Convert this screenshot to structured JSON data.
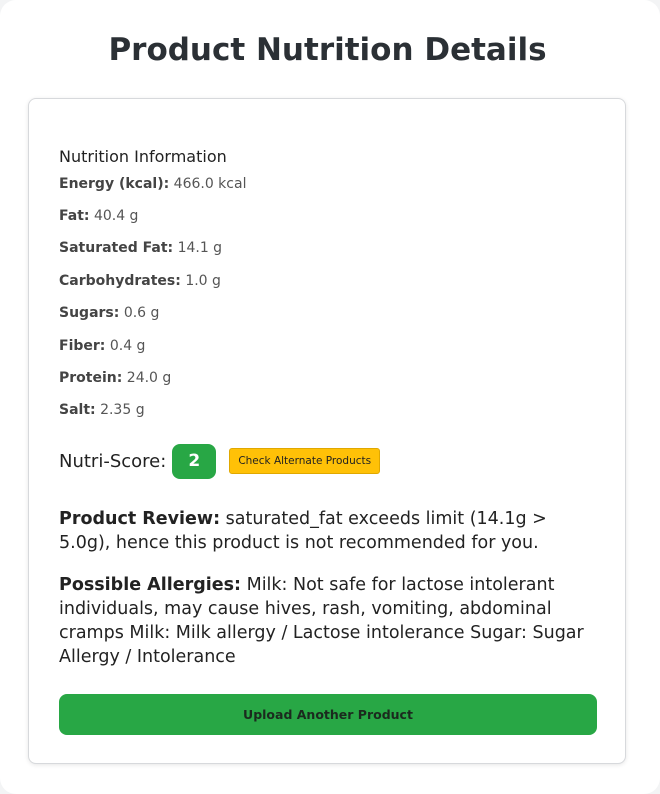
{
  "page": {
    "title": "Product Nutrition Details"
  },
  "nutrition": {
    "heading": "Nutrition Information",
    "items": [
      {
        "label": "Energy (kcal):",
        "value": "466.0 kcal"
      },
      {
        "label": "Fat:",
        "value": "40.4 g"
      },
      {
        "label": "Saturated Fat:",
        "value": "14.1 g"
      },
      {
        "label": "Carbohydrates:",
        "value": "1.0 g"
      },
      {
        "label": "Sugars:",
        "value": "0.6 g"
      },
      {
        "label": "Fiber:",
        "value": "0.4 g"
      },
      {
        "label": "Protein:",
        "value": "24.0 g"
      },
      {
        "label": "Salt:",
        "value": "2.35 g"
      }
    ]
  },
  "nutri_score": {
    "label": "Nutri-Score:",
    "value": "2",
    "badge_color": "#28a745",
    "alt_button_label": "Check Alternate Products",
    "alt_button_color": "#ffc107"
  },
  "review": {
    "label": "Product Review:",
    "text": "saturated_fat exceeds limit (14.1g > 5.0g), hence this product is not recommended for you."
  },
  "allergies": {
    "label": "Possible Allergies:",
    "text": "Milk: Not safe for lactose intolerant individuals, may cause hives, rash, vomiting, abdominal cramps Milk: Milk allergy / Lactose intolerance Sugar: Sugar Allergy / Intolerance"
  },
  "upload_button": {
    "label": "Upload Another Product",
    "color": "#28a745"
  }
}
